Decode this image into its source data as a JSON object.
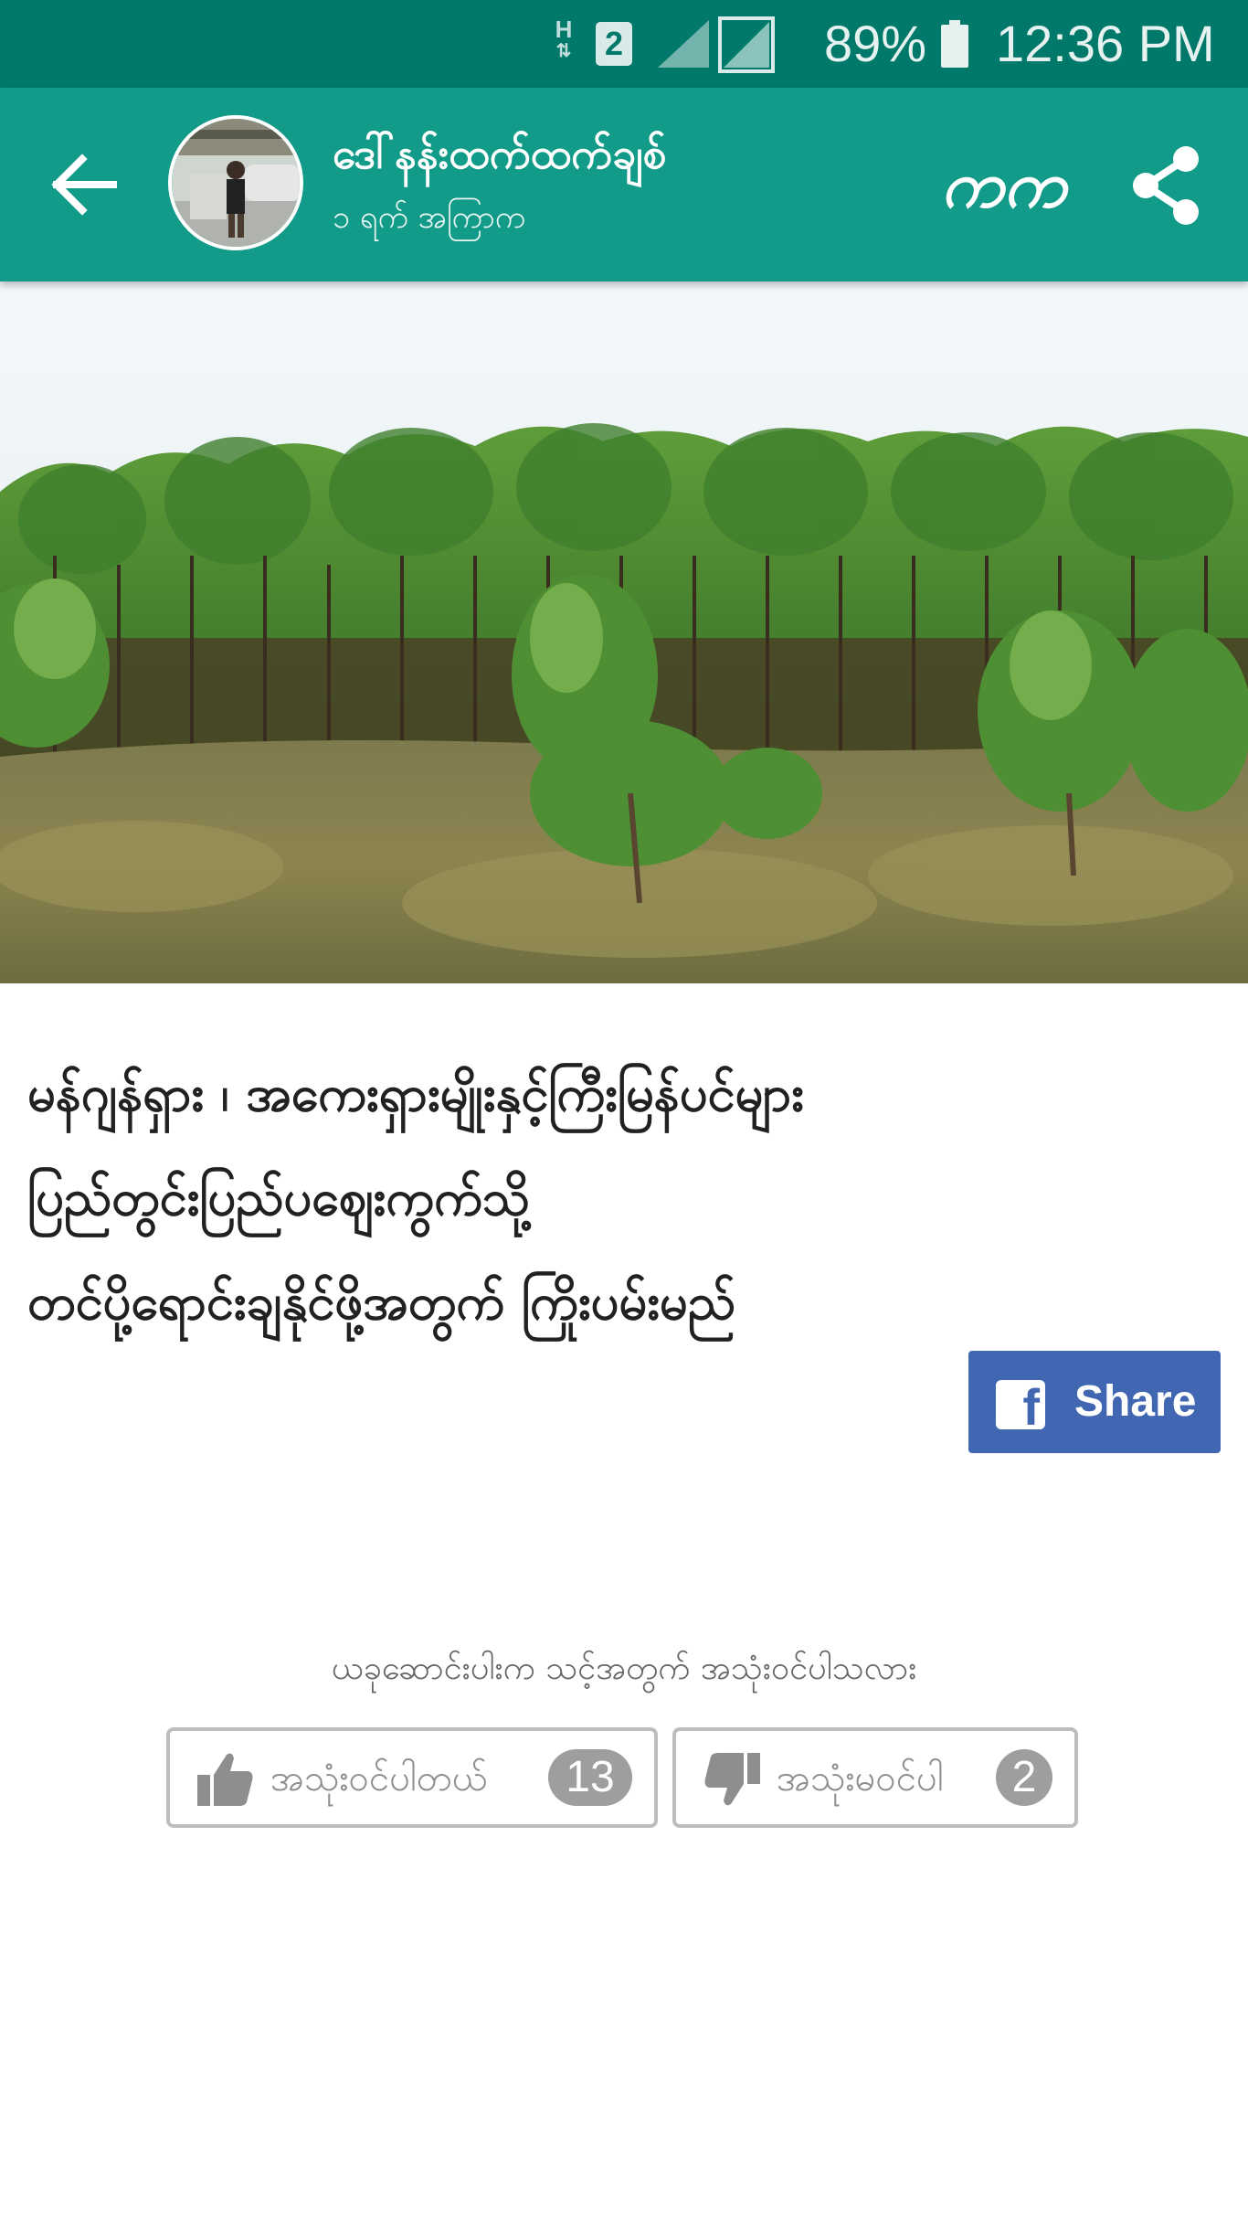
{
  "status_bar": {
    "network_type": "H",
    "sim_slot": "2",
    "battery_percent": "89%",
    "time": "12:36 PM"
  },
  "header": {
    "author_name": "ဒေါ်နန်းထက်ထက်ချစ်",
    "post_time": "၁ ရက် အကြာက",
    "font_toggle_label": "ကက",
    "icons": {
      "back": "arrow-left-icon",
      "share": "share-icon",
      "font": "font-toggle-icon"
    },
    "colors": {
      "status_bar": "#00796b",
      "app_bar": "#129b88"
    }
  },
  "article": {
    "headline_lines": [
      "မန်ဂျန်ရှား ၊ အကေးရှားမျိုးနှင့်ကြီးမြန်ပင်များ",
      "ပြည်တွင်းပြည်ပဈေးကွက်သို့",
      "တင်ပို့ရောင်းချနိုင်ဖို့အတွက် ကြိုးပမ်းမည်"
    ],
    "hero_image": "plantation-trees-photo"
  },
  "facebook_share": {
    "label": "Share",
    "color": "#4267b2"
  },
  "feedback": {
    "question": "ယခုဆောင်းပါးက သင့်အတွက် အသုံးဝင်ပါသလား",
    "useful_label": "အသုံးဝင်ပါတယ်",
    "useful_count": "13",
    "not_useful_label": "အသုံးမဝင်ပါ",
    "not_useful_count": "2"
  }
}
